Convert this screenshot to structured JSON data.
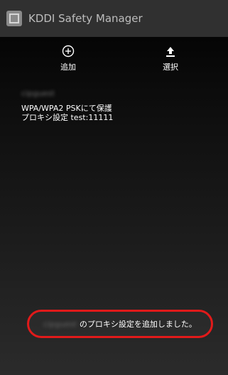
{
  "app": {
    "title": "KDDI Safety Manager",
    "icon": "app-icon"
  },
  "actions": {
    "add": {
      "label": "追加",
      "icon": "plus-circle-icon"
    },
    "select": {
      "label": "選択",
      "icon": "upload-icon"
    }
  },
  "network": {
    "ssid": "cipguest",
    "security": "WPA/WPA2 PSKにて保護",
    "proxy": "プロキシ設定 test:11111"
  },
  "toast": {
    "network_name": "cipguest",
    "message": "のプロキシ設定を追加しました。",
    "highlight_color": "#e11a1a"
  }
}
